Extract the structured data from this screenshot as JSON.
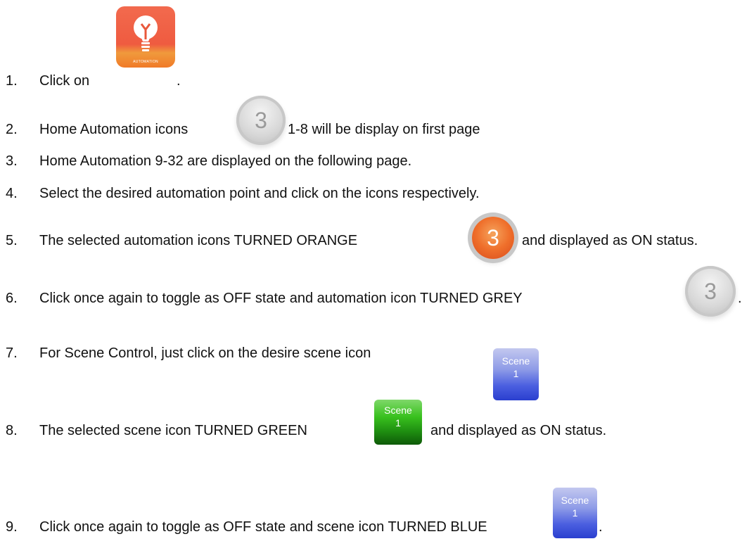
{
  "steps": [
    {
      "num": "1.",
      "text": "Click on",
      "after": "."
    },
    {
      "num": "2.",
      "text": "Home Automation icons",
      "after": "1-8 will be display on first page"
    },
    {
      "num": "3.",
      "text": "Home Automation 9-32 are displayed on the following page."
    },
    {
      "num": "4.",
      "text": "Select the desired automation point and click on the icons respectively."
    },
    {
      "num": "5.",
      "text": "The selected automation icons TURNED ORANGE",
      "after": "and displayed as ON status."
    },
    {
      "num": "6.",
      "text": "Click once again to toggle as OFF state and automation icon TURNED GREY",
      "after": "."
    },
    {
      "num": "7.",
      "text": "For Scene Control, just click on the desire scene icon"
    },
    {
      "num": "8.",
      "text": "The selected scene icon TURNED GREEN",
      "after": "and displayed as ON status."
    },
    {
      "num": "9.",
      "text": "Click once again to toggle as OFF state and scene icon TURNED BLUE",
      "after": "."
    }
  ],
  "icons": {
    "automation_label": "AUTOMATION",
    "badge_number": "3",
    "scene_word": "Scene",
    "scene_number": "1"
  },
  "colors": {
    "orange": "#ef6f2b",
    "grey": "#c8c8c8",
    "green": "#1f8f11",
    "blue": "#4b5fe0"
  }
}
